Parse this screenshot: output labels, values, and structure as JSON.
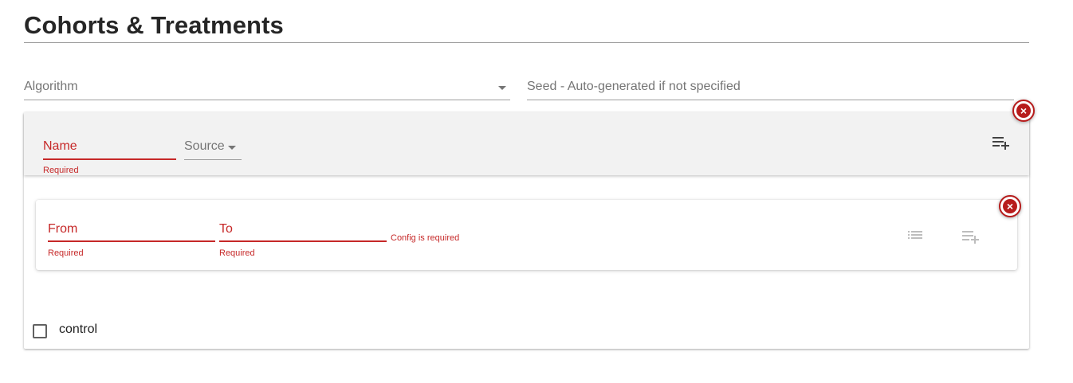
{
  "page": {
    "title": "Cohorts & Treatments"
  },
  "top_fields": {
    "algorithm": {
      "label": "Algorithm"
    },
    "seed": {
      "placeholder": "Seed - Auto-generated if not specified"
    }
  },
  "cohort": {
    "name": {
      "label": "Name",
      "error": "Required"
    },
    "source": {
      "label": "Source"
    }
  },
  "treatment": {
    "from": {
      "label": "From",
      "error": "Required"
    },
    "to": {
      "label": "To",
      "error": "Required"
    },
    "config_error": "Config is required"
  },
  "control": {
    "label": "control",
    "checked": false
  },
  "colors": {
    "error": "#c62828",
    "remove": "#b71c1c",
    "header_bg": "#f2f2f2"
  },
  "icons": {
    "remove": "close-circle-icon",
    "add_treatment": "playlist-add-icon",
    "config_list": "list-icon",
    "source_dropdown": "caret-down-icon"
  }
}
